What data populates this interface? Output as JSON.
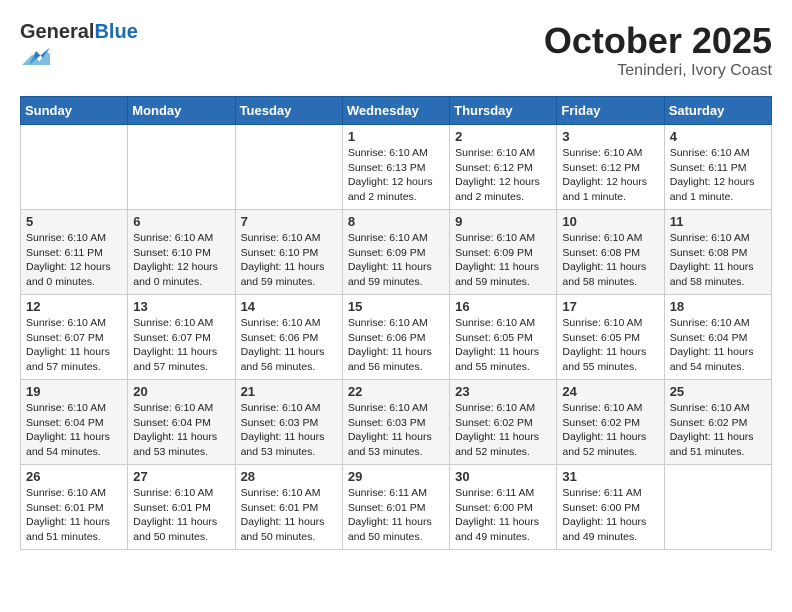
{
  "header": {
    "logo_general": "General",
    "logo_blue": "Blue",
    "month": "October 2025",
    "location": "Teninderi, Ivory Coast"
  },
  "weekdays": [
    "Sunday",
    "Monday",
    "Tuesday",
    "Wednesday",
    "Thursday",
    "Friday",
    "Saturday"
  ],
  "weeks": [
    [
      {
        "day": "",
        "info": ""
      },
      {
        "day": "",
        "info": ""
      },
      {
        "day": "",
        "info": ""
      },
      {
        "day": "1",
        "info": "Sunrise: 6:10 AM\nSunset: 6:13 PM\nDaylight: 12 hours and 2 minutes."
      },
      {
        "day": "2",
        "info": "Sunrise: 6:10 AM\nSunset: 6:12 PM\nDaylight: 12 hours and 2 minutes."
      },
      {
        "day": "3",
        "info": "Sunrise: 6:10 AM\nSunset: 6:12 PM\nDaylight: 12 hours and 1 minute."
      },
      {
        "day": "4",
        "info": "Sunrise: 6:10 AM\nSunset: 6:11 PM\nDaylight: 12 hours and 1 minute."
      }
    ],
    [
      {
        "day": "5",
        "info": "Sunrise: 6:10 AM\nSunset: 6:11 PM\nDaylight: 12 hours and 0 minutes."
      },
      {
        "day": "6",
        "info": "Sunrise: 6:10 AM\nSunset: 6:10 PM\nDaylight: 12 hours and 0 minutes."
      },
      {
        "day": "7",
        "info": "Sunrise: 6:10 AM\nSunset: 6:10 PM\nDaylight: 11 hours and 59 minutes."
      },
      {
        "day": "8",
        "info": "Sunrise: 6:10 AM\nSunset: 6:09 PM\nDaylight: 11 hours and 59 minutes."
      },
      {
        "day": "9",
        "info": "Sunrise: 6:10 AM\nSunset: 6:09 PM\nDaylight: 11 hours and 59 minutes."
      },
      {
        "day": "10",
        "info": "Sunrise: 6:10 AM\nSunset: 6:08 PM\nDaylight: 11 hours and 58 minutes."
      },
      {
        "day": "11",
        "info": "Sunrise: 6:10 AM\nSunset: 6:08 PM\nDaylight: 11 hours and 58 minutes."
      }
    ],
    [
      {
        "day": "12",
        "info": "Sunrise: 6:10 AM\nSunset: 6:07 PM\nDaylight: 11 hours and 57 minutes."
      },
      {
        "day": "13",
        "info": "Sunrise: 6:10 AM\nSunset: 6:07 PM\nDaylight: 11 hours and 57 minutes."
      },
      {
        "day": "14",
        "info": "Sunrise: 6:10 AM\nSunset: 6:06 PM\nDaylight: 11 hours and 56 minutes."
      },
      {
        "day": "15",
        "info": "Sunrise: 6:10 AM\nSunset: 6:06 PM\nDaylight: 11 hours and 56 minutes."
      },
      {
        "day": "16",
        "info": "Sunrise: 6:10 AM\nSunset: 6:05 PM\nDaylight: 11 hours and 55 minutes."
      },
      {
        "day": "17",
        "info": "Sunrise: 6:10 AM\nSunset: 6:05 PM\nDaylight: 11 hours and 55 minutes."
      },
      {
        "day": "18",
        "info": "Sunrise: 6:10 AM\nSunset: 6:04 PM\nDaylight: 11 hours and 54 minutes."
      }
    ],
    [
      {
        "day": "19",
        "info": "Sunrise: 6:10 AM\nSunset: 6:04 PM\nDaylight: 11 hours and 54 minutes."
      },
      {
        "day": "20",
        "info": "Sunrise: 6:10 AM\nSunset: 6:04 PM\nDaylight: 11 hours and 53 minutes."
      },
      {
        "day": "21",
        "info": "Sunrise: 6:10 AM\nSunset: 6:03 PM\nDaylight: 11 hours and 53 minutes."
      },
      {
        "day": "22",
        "info": "Sunrise: 6:10 AM\nSunset: 6:03 PM\nDaylight: 11 hours and 53 minutes."
      },
      {
        "day": "23",
        "info": "Sunrise: 6:10 AM\nSunset: 6:02 PM\nDaylight: 11 hours and 52 minutes."
      },
      {
        "day": "24",
        "info": "Sunrise: 6:10 AM\nSunset: 6:02 PM\nDaylight: 11 hours and 52 minutes."
      },
      {
        "day": "25",
        "info": "Sunrise: 6:10 AM\nSunset: 6:02 PM\nDaylight: 11 hours and 51 minutes."
      }
    ],
    [
      {
        "day": "26",
        "info": "Sunrise: 6:10 AM\nSunset: 6:01 PM\nDaylight: 11 hours and 51 minutes."
      },
      {
        "day": "27",
        "info": "Sunrise: 6:10 AM\nSunset: 6:01 PM\nDaylight: 11 hours and 50 minutes."
      },
      {
        "day": "28",
        "info": "Sunrise: 6:10 AM\nSunset: 6:01 PM\nDaylight: 11 hours and 50 minutes."
      },
      {
        "day": "29",
        "info": "Sunrise: 6:11 AM\nSunset: 6:01 PM\nDaylight: 11 hours and 50 minutes."
      },
      {
        "day": "30",
        "info": "Sunrise: 6:11 AM\nSunset: 6:00 PM\nDaylight: 11 hours and 49 minutes."
      },
      {
        "day": "31",
        "info": "Sunrise: 6:11 AM\nSunset: 6:00 PM\nDaylight: 11 hours and 49 minutes."
      },
      {
        "day": "",
        "info": ""
      }
    ]
  ]
}
